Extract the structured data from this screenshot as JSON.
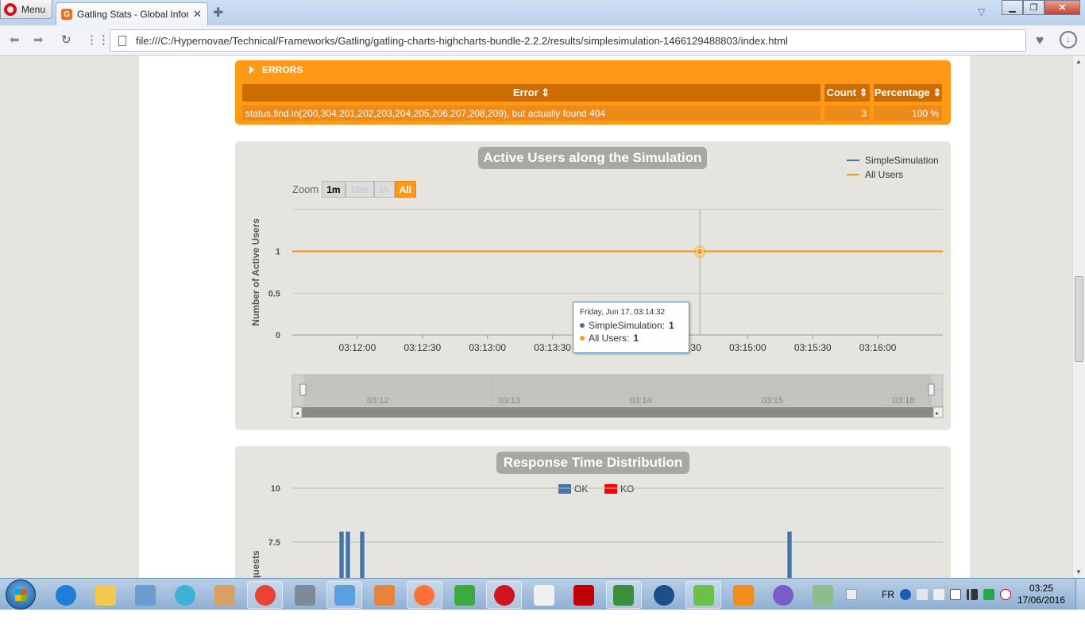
{
  "browser": {
    "menu_label": "Menu",
    "tab_title": "Gatling Stats - Global Infor",
    "tab_favicon_letter": "G",
    "url": "file:///C:/Hypernovae/Technical/Frameworks/Gatling/gatling-charts-highcharts-bundle-2.2.2/results/simplesimulation-1466129488803/index.html",
    "icons": [
      "back-icon",
      "forward-icon",
      "reload-icon",
      "speed-dial-icon",
      "page-icon",
      "heart-icon",
      "download-icon",
      "new-tab-icon",
      "tab-menu-icon"
    ]
  },
  "errors": {
    "title": "ERRORS",
    "headers": {
      "error": "Error ⇕",
      "count": "Count ⇕",
      "percentage": "Percentage ⇕"
    },
    "rows": [
      {
        "error": "status.find.in(200,304,201,202,203,204,205,206,207,208,209), but actually found 404",
        "count": "3",
        "percentage": "100 %"
      }
    ],
    "colors": {
      "panel": "#ff9916",
      "header": "#cd6c00",
      "row": "#ee8a1a"
    }
  },
  "active_users_chart": {
    "title": "Active Users along the Simulation",
    "zoom_label": "Zoom",
    "zoom_buttons": [
      "1m",
      "10m",
      "1h",
      "All"
    ],
    "y_axis_title": "Number of Active Users",
    "y_ticks": [
      "0",
      "0.5",
      "1"
    ],
    "x_ticks": [
      "03:12:00",
      "03:12:30",
      "03:13:00",
      "03:13:30",
      "03:14:00",
      "03:14:30",
      "03:15:00",
      "03:15:30",
      "03:16:00"
    ],
    "navigator_ticks": [
      "03:12",
      "03:13",
      "03:14",
      "03:15",
      "03:16"
    ],
    "legend": [
      {
        "name": "SimpleSimulation",
        "color": "#4572a7"
      },
      {
        "name": "All Users",
        "color": "#ff9916"
      }
    ],
    "tooltip": {
      "date": "Friday, Jun 17, 03:14:32",
      "rows": [
        {
          "label": "SimpleSimulation:",
          "value": "1",
          "color": "#4572a7"
        },
        {
          "label": "All Users:",
          "value": "1",
          "color": "#ff9916"
        }
      ]
    }
  },
  "response_chart": {
    "title": "Response Time Distribution",
    "y_axis_title": "Number of Requests",
    "y_ticks": [
      "7.5",
      "10"
    ],
    "legend": [
      {
        "name": "OK",
        "color": "#4572a7"
      },
      {
        "name": "KO",
        "color": "#ff0000"
      }
    ]
  },
  "chart_data": [
    {
      "type": "line",
      "title": "Active Users along the Simulation",
      "ylabel": "Number of Active Users",
      "ylim": [
        0,
        1.5
      ],
      "x": [
        "03:11:30",
        "03:16:30"
      ],
      "series": [
        {
          "name": "SimpleSimulation",
          "values": [
            1,
            1
          ]
        },
        {
          "name": "All Users",
          "values": [
            1,
            1
          ]
        }
      ],
      "legend": "top-right"
    },
    {
      "type": "bar",
      "title": "Response Time Distribution",
      "ylabel": "Number of Requests",
      "ylim": [
        0,
        10
      ],
      "series": [
        {
          "name": "OK",
          "values": [
            8,
            8,
            8,
            8
          ]
        },
        {
          "name": "KO",
          "values": [
            0,
            0,
            0,
            0
          ]
        }
      ],
      "legend": "top-center"
    }
  ],
  "taskbar": {
    "language": "FR",
    "time": "03:25",
    "date": "17/06/2016",
    "apps": [
      "ie-icon",
      "explorer-icon",
      "control-panel-icon",
      "app-circle-icon",
      "java-icon",
      "chrome-icon",
      "laptop-settings-icon",
      "paint-icon",
      "media-player-icon",
      "firefox-icon",
      "green-app-icon",
      "opera-icon",
      "bookmark-app-icon",
      "acrobat-icon",
      "chart-app-icon",
      "music-app-icon",
      "paper-plane-icon",
      "vlc-icon",
      "cat-app-icon",
      "map-app-icon"
    ]
  }
}
